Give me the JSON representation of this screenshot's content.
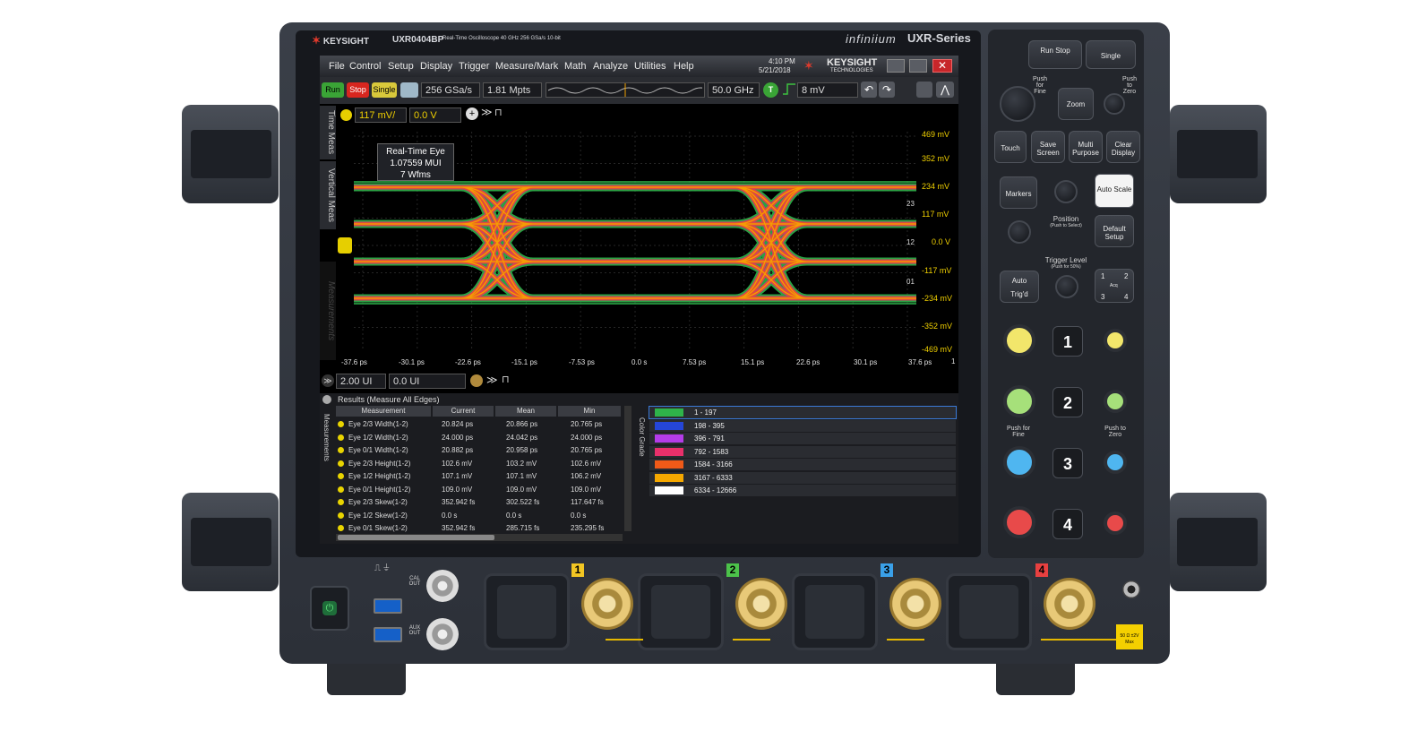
{
  "header": {
    "brand": "KEYSIGHT",
    "model": "UXR0404BP",
    "model_desc": "Real-Time Oscilloscope   40 GHz   256 GSa/s   10-bit",
    "product_line": "infiniium",
    "series": "UXR-Series"
  },
  "menu": {
    "items": [
      "File",
      "Control",
      "Setup",
      "Display",
      "Trigger",
      "Measure/Mark",
      "Math",
      "Analyze",
      "Utilities",
      "Help"
    ],
    "time": "4:10 PM",
    "date": "5/21/2018",
    "logo_main": "KEYSIGHT",
    "logo_sub": "TECHNOLOGIES"
  },
  "toolbar": {
    "run": "Run",
    "stop": "Stop",
    "single": "Single",
    "sample_rate": "256 GSa/s",
    "memory": "1.81 Mpts",
    "bandwidth": "50.0 GHz",
    "trigger_badge": "T",
    "trigger_level": "8 mV"
  },
  "channel_bar": {
    "scale": "117 mV/",
    "offset": "0.0 V"
  },
  "side_tabs": [
    "Time Meas",
    "Vertical Meas",
    "Measurements"
  ],
  "plot": {
    "overlay_title": "Real-Time Eye",
    "overlay_value": "1.07559 MUI",
    "overlay_count": "7 Wfms",
    "y_labels": [
      "469 mV",
      "352 mV",
      "234 mV",
      "117 mV",
      "0.0 V",
      "-117 mV",
      "-234 mV",
      "-352 mV",
      "-469 mV"
    ],
    "x_labels": [
      "-37.6 ps",
      "-30.1 ps",
      "-22.6 ps",
      "-15.1 ps",
      "-7.53 ps",
      "0.0 s",
      "7.53 ps",
      "15.1 ps",
      "22.6 ps",
      "30.1 ps",
      "37.6 ps"
    ],
    "right_markers": [
      "23",
      "12",
      "01"
    ],
    "corner_marker": "1"
  },
  "time_bar": {
    "scale": "2.00 UI",
    "position": "0.0 UI"
  },
  "results": {
    "title": "Results (Measure All Edges)",
    "tab_label": "Measurements",
    "columns": [
      "Measurement",
      "Current",
      "Mean",
      "Min"
    ],
    "rows": [
      [
        "Eye 2/3 Width(1-2)",
        "20.824 ps",
        "20.866 ps",
        "20.765 ps"
      ],
      [
        "Eye 1/2 Width(1-2)",
        "24.000 ps",
        "24.042 ps",
        "24.000 ps"
      ],
      [
        "Eye 0/1 Width(1-2)",
        "20.882 ps",
        "20.958 ps",
        "20.765 ps"
      ],
      [
        "Eye 2/3 Height(1-2)",
        "102.6 mV",
        "103.2 mV",
        "102.6 mV"
      ],
      [
        "Eye 1/2 Height(1-2)",
        "107.1 mV",
        "107.1 mV",
        "106.2 mV"
      ],
      [
        "Eye 0/1 Height(1-2)",
        "109.0 mV",
        "109.0 mV",
        "109.0 mV"
      ],
      [
        "Eye 2/3 Skew(1-2)",
        "352.942 fs",
        "302.522 fs",
        "117.647 fs"
      ],
      [
        "Eye 1/2 Skew(1-2)",
        "0.0 s",
        "0.0 s",
        "0.0 s"
      ],
      [
        "Eye 0/1 Skew(1-2)",
        "352.942 fs",
        "285.715 fs",
        "235.295 fs"
      ]
    ]
  },
  "color_grade": {
    "tab_label": "Color Grade",
    "ranges": [
      {
        "label": "1 - 197",
        "color": "#2fb34a"
      },
      {
        "label": "198 - 395",
        "color": "#2546d8"
      },
      {
        "label": "396 - 791",
        "color": "#b43ce8"
      },
      {
        "label": "792 - 1583",
        "color": "#e8306b"
      },
      {
        "label": "1584 - 3166",
        "color": "#f05a18"
      },
      {
        "label": "3167 - 6333",
        "color": "#f6a800"
      },
      {
        "label": "6334 - 12666",
        "color": "#ffffff"
      }
    ]
  },
  "right_panel": {
    "run_stop": "Run Stop",
    "single": "Single",
    "push_fine": "Push for Fine",
    "push_zero": "Push to Zero",
    "zoom": "Zoom",
    "touch": "Touch",
    "save_screen": "Save Screen",
    "multi_purpose": "Multi Purpose",
    "clear_display": "Clear Display",
    "markers": "Markers",
    "auto_scale": "Auto Scale",
    "position": "Position",
    "position_sub": "(Push to Select)",
    "default_setup": "Default Setup",
    "trigger_level": "Trigger Level",
    "trigger_sub": "(Push for 50%)",
    "auto": "Auto",
    "trigd": "Trig'd",
    "acq_keys": [
      "1",
      "2",
      "Acq",
      "3",
      "4"
    ],
    "channels": [
      "1",
      "2",
      "3",
      "4"
    ],
    "push_fine_2": "Push for Fine",
    "push_zero_2": "Push to Zero"
  },
  "front_panel": {
    "cal_out": "CAL OUT",
    "aux_out": "AUX OUT",
    "channel_labels": [
      "1",
      "2",
      "3",
      "4"
    ],
    "channel_colors": [
      "#f2c623",
      "#4cc24a",
      "#3aa0e8",
      "#e84040"
    ],
    "warning": "50 Ω ±2V Max"
  },
  "colors": {
    "chassis": "#2f333b",
    "screen": "#000000",
    "ch1": "#f0d000"
  }
}
